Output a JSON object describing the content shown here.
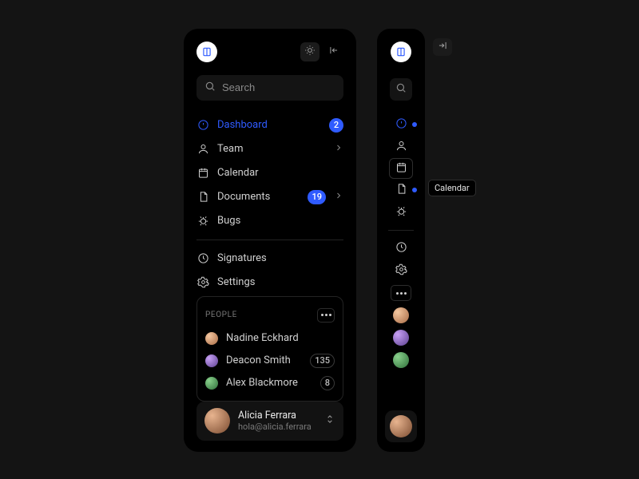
{
  "search": {
    "placeholder": "Search"
  },
  "nav": {
    "items": [
      {
        "label": "Dashboard",
        "badge": "2"
      },
      {
        "label": "Team"
      },
      {
        "label": "Calendar"
      },
      {
        "label": "Documents",
        "badge": "19"
      },
      {
        "label": "Bugs"
      }
    ],
    "secondary": [
      {
        "label": "Signatures"
      },
      {
        "label": "Settings"
      }
    ]
  },
  "people": {
    "title": "PEOPLE",
    "list": [
      {
        "name": "Nadine Eckhard"
      },
      {
        "name": "Deacon Smith",
        "count": "135"
      },
      {
        "name": "Alex Blackmore",
        "count": "8"
      }
    ]
  },
  "user": {
    "name": "Alicia Ferrara",
    "email": "hola@alicia.ferrara"
  },
  "tooltip": {
    "calendar": "Calendar"
  }
}
